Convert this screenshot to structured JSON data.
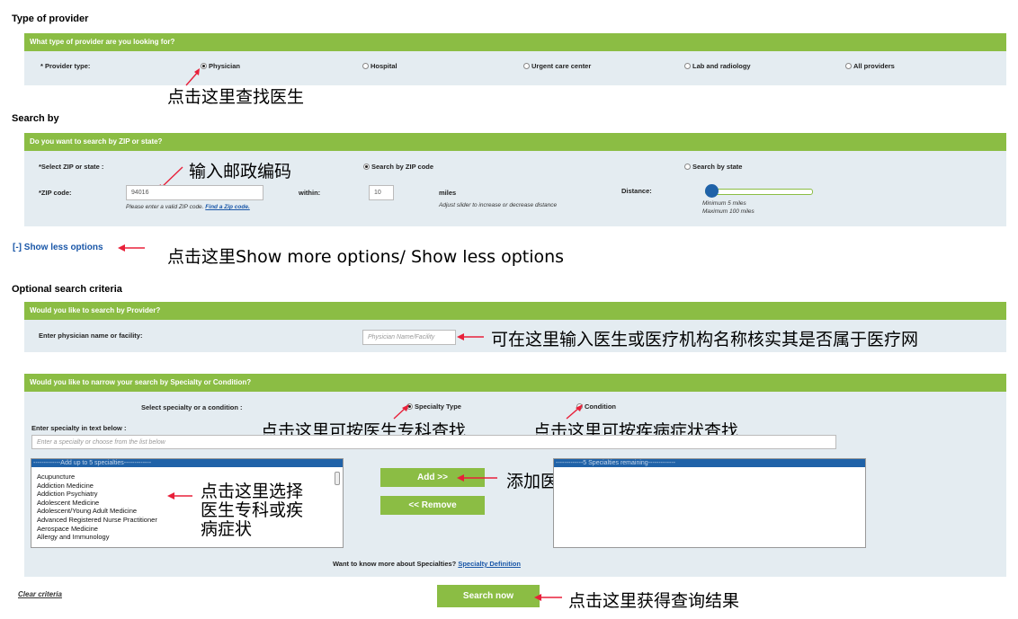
{
  "colors": {
    "green": "#8bbd44",
    "panel": "#e4ecf1",
    "red": "#e8203a",
    "link": "#1a57a8",
    "list_header": "#1f62a8"
  },
  "provider": {
    "section_title": "Type of provider",
    "question": "What type of provider are you looking for?",
    "label": "* Provider type:",
    "options": [
      "Physician",
      "Hospital",
      "Urgent care center",
      "Lab and radiology",
      "All providers"
    ],
    "selected": "Physician",
    "annotation": "点击这里查找医生"
  },
  "search_by": {
    "section_title": "Search by",
    "question": "Do you want to search by ZIP or state?",
    "select_label": "*Select ZIP or state :",
    "option_zip": "Search by ZIP code",
    "option_state": "Search by state",
    "zip_label": "*ZIP code:",
    "zip_value": "94016",
    "zip_hint": "Please enter a valid ZIP code.",
    "find_zip_link": "Find a Zip code.",
    "within_label": "within:",
    "within_value": "10",
    "miles": "miles",
    "slider_hint": "Adjust slider to increase or decrease distance",
    "distance_label": "Distance:",
    "distance_min": "Minimum 5 miles",
    "distance_max": "Maximum 100 miles",
    "slider_value_miles": 10,
    "annotation": "输入邮政编码"
  },
  "options_toggle": {
    "label": "[-] Show less options",
    "annotation": "点击这里Show more options/ Show less options"
  },
  "optional": {
    "section_title": "Optional search criteria",
    "provider_question": "Would you like to search by Provider?",
    "name_label": "Enter physician name or facility:",
    "name_placeholder": "Physician Name/Facility",
    "name_annotation": "可在这里输入医生或医疗机构名称核实其是否属于医疗网",
    "specialty_question": "Would you like to narrow your search by Specialty or Condition?",
    "select_label": "Select specialty or a condition :",
    "specialty_type": "Specialty Type",
    "condition": "Condition",
    "specialty_annotation": "点击这里可按医生专科查找",
    "condition_annotation": "点击这里可按疾病症状查找",
    "text_label": "Enter specialty in text below :",
    "text_placeholder": "Enter a specialty or choose from the list below",
    "list_header": "-------------Add up to 5 specialties-------------",
    "list_items": [
      "Acupuncture",
      "Addiction Medicine",
      "Addiction Psychiatry",
      "Adolescent Medicine",
      "Adolescent/Young Adult Medicine",
      "Advanced Registered Nurse Practitioner",
      "Aerospace Medicine",
      "Allergy and Immunology"
    ],
    "list_annotation": "点击这里选择\n医生专科或疾\n病症状",
    "add_button": "Add >>",
    "remove_button": "<< Remove",
    "add_annotation": "添加医生专科或疾病症状",
    "remaining_header": "-------------5  Specialties remaining-------------",
    "more_text": "Want to know more about Specialties?",
    "definition_link": "Specialty Definition"
  },
  "footer": {
    "clear": "Clear criteria",
    "search_button": "Search now",
    "search_annotation": "点击这里获得查询结果"
  }
}
